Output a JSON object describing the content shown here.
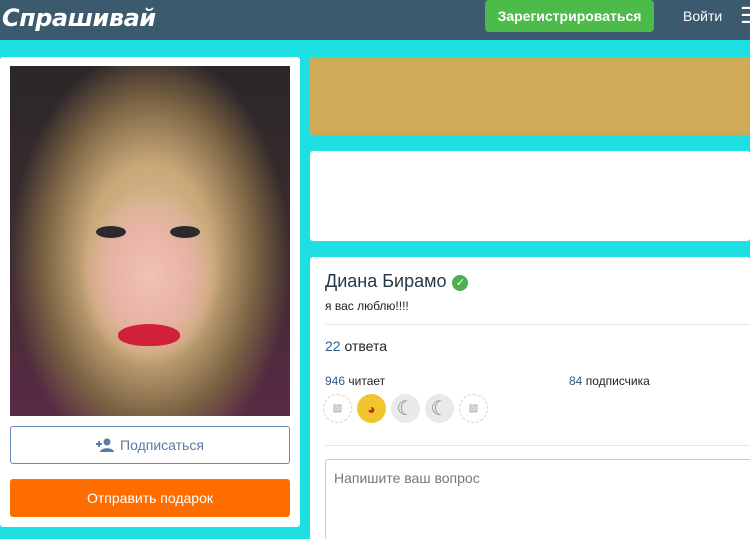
{
  "header": {
    "logo": "Спрашивай",
    "register_label": "Зарегистрироваться",
    "login_label": "Войти",
    "menu_icon": "menu-icon"
  },
  "sidebar": {
    "subscribe_label": "Подписаться",
    "gift_label": "Отправить подарок"
  },
  "profile": {
    "name": "Диана Бирамо",
    "verified_icon": "✓",
    "status": "я вас люблю!!!!",
    "answers_count": "22",
    "answers_label": "ответа",
    "readers_count": "946",
    "readers_label": "читает",
    "subscribers_count": "84",
    "subscribers_label": "подписчика",
    "followers": [
      {
        "type": "broken-image-icon"
      },
      {
        "type": "emoji-avatar-icon"
      },
      {
        "type": "moon-avatar-icon"
      },
      {
        "type": "moon-avatar-icon"
      },
      {
        "type": "broken-image-icon"
      }
    ]
  },
  "question": {
    "placeholder": "Напишите ваш вопрос"
  },
  "colors": {
    "page_bg": "#1ee0e3",
    "topbar": "#3b5a6e",
    "register": "#4cbb4a",
    "gift": "#ff6d00",
    "banner": "#cfab57"
  }
}
